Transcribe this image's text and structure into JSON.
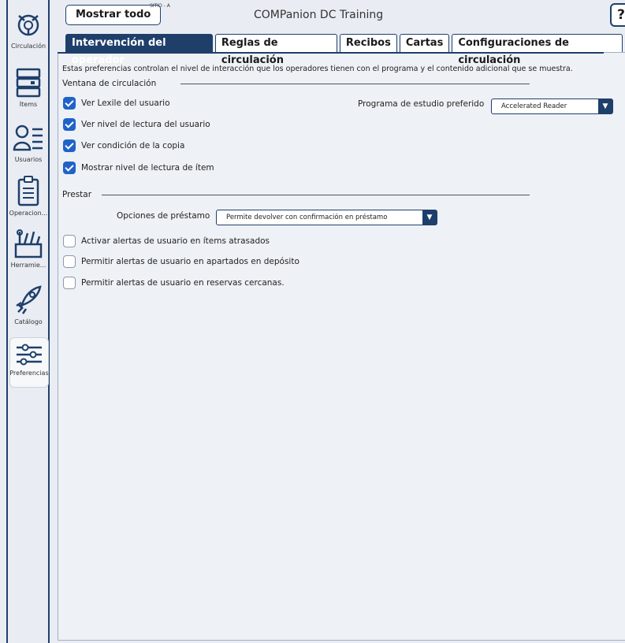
{
  "app": {
    "title": "COMPanion DC Training",
    "site_label": "SITIO - A",
    "show_all_label": "Mostrar todo",
    "help_glyph": "?"
  },
  "sidebar": {
    "items": [
      {
        "label": "Circulación",
        "icon": "circulation-icon"
      },
      {
        "label": "Ítems",
        "icon": "books-icon"
      },
      {
        "label": "Usuarios",
        "icon": "users-icon"
      },
      {
        "label": "Operacion...",
        "icon": "clipboard-icon"
      },
      {
        "label": "Herramie...",
        "icon": "tools-icon"
      },
      {
        "label": "Catálogo",
        "icon": "rocket-icon"
      },
      {
        "label": "Preferencias",
        "icon": "sliders-icon"
      }
    ]
  },
  "tabs": [
    {
      "label": "Intervención del operador",
      "active": true
    },
    {
      "label": "Reglas de circulación"
    },
    {
      "label": "Recibos"
    },
    {
      "label": "Cartas"
    },
    {
      "label": "Configuraciones de circulación"
    }
  ],
  "content": {
    "description": "Estas preferencias controlan el nivel de interacción que los operadores tienen con el programa y el contenido adicional que se muestra.",
    "circ_window": {
      "title": "Ventana de circulación",
      "checkboxes": [
        {
          "label": "Ver Lexile del usuario",
          "checked": true
        },
        {
          "label": "Ver nivel de lectura del usuario",
          "checked": true
        },
        {
          "label": "Ver condición de la copia",
          "checked": true
        },
        {
          "label": "Mostrar nivel de lectura de ítem",
          "checked": true
        }
      ],
      "study_program": {
        "label": "Programa de estudio preferido",
        "value": "Accelerated Reader"
      }
    },
    "lend": {
      "title": "Prestar",
      "loan_options": {
        "label": "Opciones de préstamo",
        "value": "Permite devolver con confirmación en préstamo"
      },
      "checkboxes": [
        {
          "label": "Activar alertas de usuario en ítems atrasados",
          "checked": false
        },
        {
          "label": "Permitir alertas de usuario en apartados en depósito",
          "checked": false
        },
        {
          "label": "Permitir alertas de usuario en reservas cercanas.",
          "checked": false
        }
      ]
    }
  },
  "colors": {
    "accent": "#1f3f6b",
    "checkbox": "#1f63c9",
    "background": "#e9edf3"
  }
}
